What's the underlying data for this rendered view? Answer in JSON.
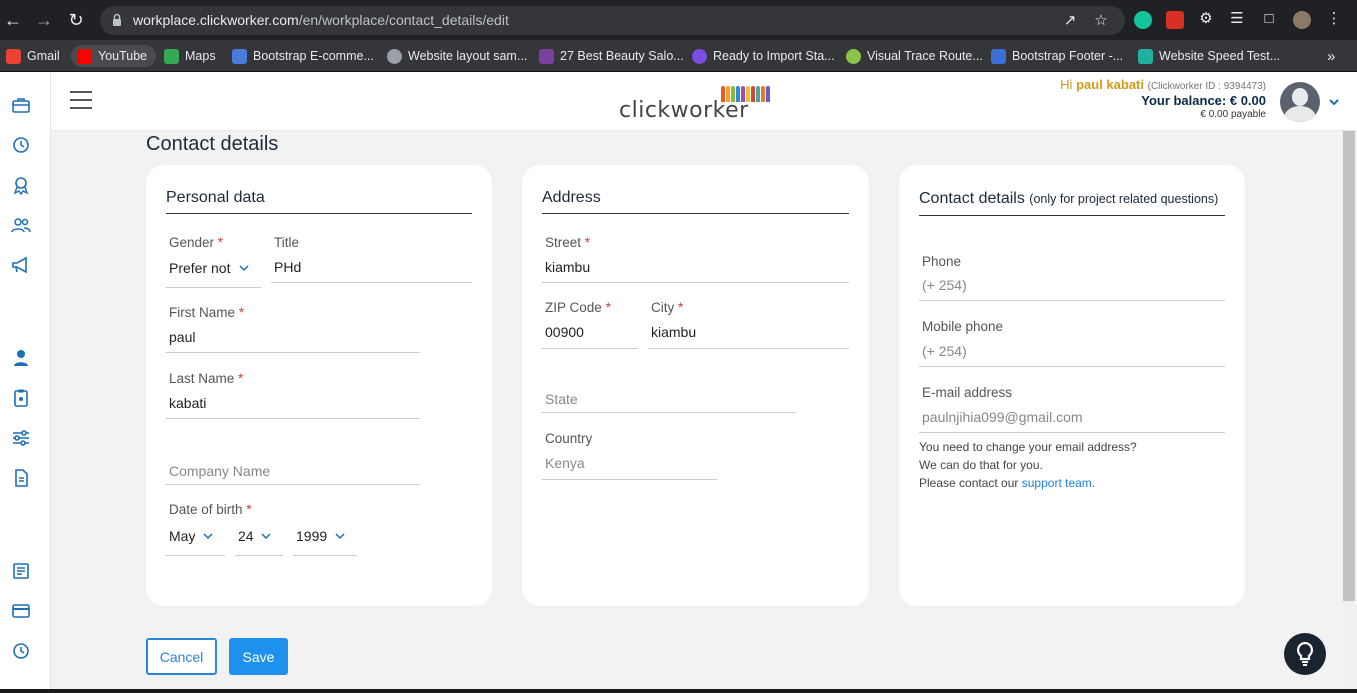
{
  "browser": {
    "url_host": "workplace.clickworker.com",
    "url_path": "/en/workplace/contact_details/edit",
    "bookmarks": [
      {
        "label": "Gmail",
        "color": "#ea4335"
      },
      {
        "label": "YouTube",
        "color": "#ff0000"
      },
      {
        "label": "Maps",
        "color": "#34a853"
      },
      {
        "label": "Bootstrap E-comme...",
        "color": "#4a7bd8"
      },
      {
        "label": "Website layout sam...",
        "color": "#9aa0a6"
      },
      {
        "label": "27 Best Beauty Salo...",
        "color": "#7b3fa0"
      },
      {
        "label": "Ready to Import Sta...",
        "color": "#7b4de0"
      },
      {
        "label": "Visual Trace Route...",
        "color": "#8bc34a"
      },
      {
        "label": "Bootstrap Footer -...",
        "color": "#3b6fd8"
      },
      {
        "label": "Website Speed Test...",
        "color": "#20b0a0"
      }
    ],
    "more": "»"
  },
  "header": {
    "greeting": "Hi",
    "user_name": "paul kabati",
    "clickworker_id": "(Clickworker ID : 9394473)",
    "balance": "Your balance: € 0.00",
    "payable": "€ 0.00 payable",
    "logo_text": "clickworker"
  },
  "page": {
    "title": "Contact details"
  },
  "personal": {
    "heading": "Personal data",
    "gender_label": "Gender",
    "gender_value": "Prefer not to say",
    "title_label": "Title",
    "title_value": "PHd",
    "first_name_label": "First Name",
    "first_name_value": "paul",
    "last_name_label": "Last Name",
    "last_name_value": "kabati",
    "company_placeholder": "Company Name",
    "dob_label": "Date of birth",
    "dob_month": "May",
    "dob_day": "24",
    "dob_year": "1999",
    "required_mark": "*"
  },
  "address": {
    "heading": "Address",
    "street_label": "Street",
    "street_value": "kiambu",
    "zip_label": "ZIP Code",
    "zip_value": "00900",
    "city_label": "City",
    "city_value": "kiambu",
    "state_placeholder": "State",
    "country_label": "Country",
    "country_value": "Kenya"
  },
  "contact": {
    "heading": "Contact details",
    "heading_note": "(only for project related questions)",
    "phone_label": "Phone",
    "phone_value": "(+ 254)",
    "mobile_label": "Mobile phone",
    "mobile_value": "(+ 254)",
    "email_label": "E-mail address",
    "email_value": "paulnjihia099@gmail.com",
    "hint_line1": "You need to change your email address?",
    "hint_line2": "We can do that for you.",
    "hint_line3_prefix": "Please contact our",
    "hint_link": "support team",
    "hint_suffix": "."
  },
  "actions": {
    "cancel": "Cancel",
    "save": "Save"
  },
  "colors": {
    "accent": "#1e90ee",
    "greeting": "#d69a1a",
    "required": "#d93a3a"
  }
}
